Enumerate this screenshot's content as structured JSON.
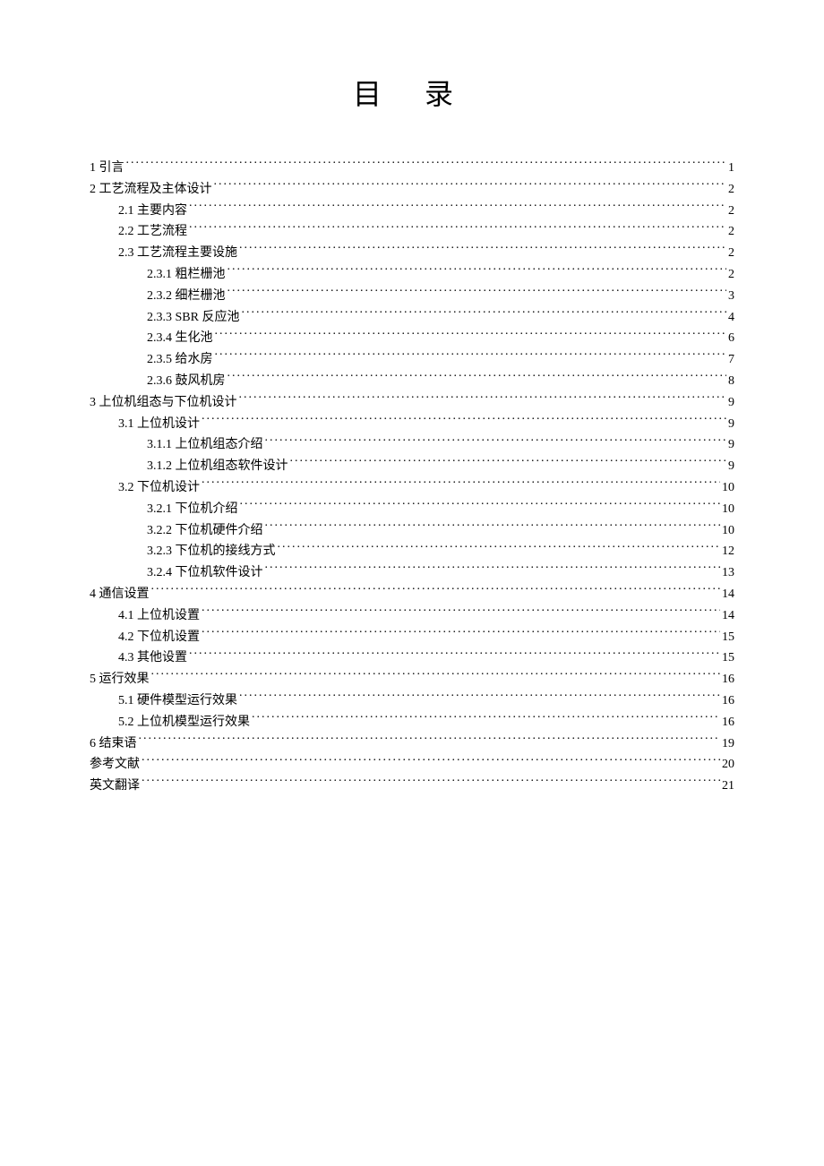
{
  "title": "目 录",
  "entries": [
    {
      "level": 1,
      "label": "1 引言",
      "page": "1"
    },
    {
      "level": 1,
      "label": "2 工艺流程及主体设计",
      "page": "2"
    },
    {
      "level": 2,
      "label": "2.1 主要内容",
      "page": "2"
    },
    {
      "level": 2,
      "label": "2.2 工艺流程",
      "page": "2"
    },
    {
      "level": 2,
      "label": "2.3 工艺流程主要设施",
      "page": "2"
    },
    {
      "level": 3,
      "label": "2.3.1  粗栏栅池",
      "page": "2"
    },
    {
      "level": 3,
      "label": "2.3.2  细栏栅池",
      "page": "3"
    },
    {
      "level": 3,
      "label": "2.3.3 SBR 反应池",
      "page": "4"
    },
    {
      "level": 3,
      "label": "2.3.4  生化池",
      "page": "6"
    },
    {
      "level": 3,
      "label": "2.3.5  给水房",
      "page": "7"
    },
    {
      "level": 3,
      "label": "2.3.6  鼓风机房",
      "page": "8"
    },
    {
      "level": 1,
      "label": "3  上位机组态与下位机设计",
      "page": "9"
    },
    {
      "level": 2,
      "label": "3.1  上位机设计",
      "page": "9"
    },
    {
      "level": 3,
      "label": "3.1.1 上位机组态介绍",
      "page": "9"
    },
    {
      "level": 3,
      "label": "3.1.2 上位机组态软件设计",
      "page": "9"
    },
    {
      "level": 2,
      "label": "3.2  下位机设计",
      "page": "10"
    },
    {
      "level": 3,
      "label": "3.2.1  下位机介绍",
      "page": "10"
    },
    {
      "level": 3,
      "label": "3.2.2  下位机硬件介绍",
      "page": "10"
    },
    {
      "level": 3,
      "label": "3.2.3  下位机的接线方式",
      "page": "12"
    },
    {
      "level": 3,
      "label": "3.2.4  下位机软件设计",
      "page": "13"
    },
    {
      "level": 1,
      "label": "4  通信设置",
      "page": "14"
    },
    {
      "level": 2,
      "label": "4.1  上位机设置",
      "page": "14"
    },
    {
      "level": 2,
      "label": "4.2  下位机设置",
      "page": "15"
    },
    {
      "level": 2,
      "label": "4.3  其他设置",
      "page": "15"
    },
    {
      "level": 1,
      "label": "5  运行效果",
      "page": "16"
    },
    {
      "level": 2,
      "label": "5.1  硬件模型运行效果",
      "page": "16"
    },
    {
      "level": 2,
      "label": "5.2  上位机模型运行效果",
      "page": "16"
    },
    {
      "level": 1,
      "label": "6  结束语",
      "page": "19"
    },
    {
      "level": 1,
      "label": "参考文献",
      "page": "20"
    },
    {
      "level": 1,
      "label": "英文翻译",
      "page": "21"
    }
  ]
}
